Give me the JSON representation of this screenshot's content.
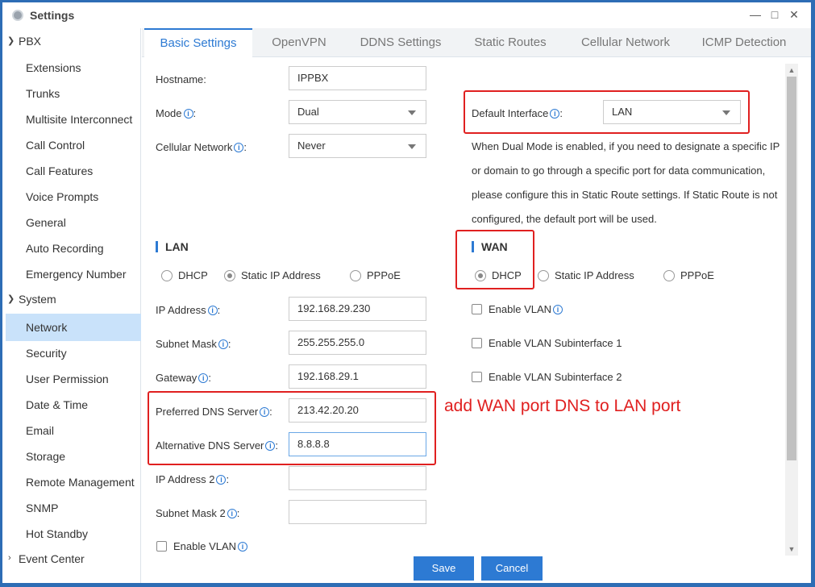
{
  "window": {
    "title": "Settings"
  },
  "sidebar": {
    "groups": [
      {
        "label": "PBX",
        "items": [
          "Extensions",
          "Trunks",
          "Multisite Interconnect",
          "Call Control",
          "Call Features",
          "Voice Prompts",
          "General",
          "Auto Recording",
          "Emergency Number"
        ]
      },
      {
        "label": "System",
        "items": [
          "Network",
          "Security",
          "User Permission",
          "Date & Time",
          "Email",
          "Storage",
          "Remote Management",
          "SNMP",
          "Hot Standby"
        ]
      },
      {
        "label": "Event Center",
        "items": []
      }
    ],
    "active_item": "Network"
  },
  "tabs": [
    "Basic Settings",
    "OpenVPN",
    "DDNS Settings",
    "Static Routes",
    "Cellular Network",
    "ICMP Detection"
  ],
  "form": {
    "hostname_label": "Hostname:",
    "hostname_value": "IPPBX",
    "mode_label": "Mode",
    "mode_value": "Dual",
    "cellular_label": "Cellular Network",
    "cellular_value": "Never",
    "default_interface_label": "Default Interface",
    "default_interface_value": "LAN",
    "colon": ":",
    "description": "When Dual Mode is enabled, if you need to designate a specific IP or domain to go through a specific port for data communication, please configure this in Static Route settings. If Static Route is not configured, the default port will be used."
  },
  "lan": {
    "title": "LAN",
    "radios": [
      "DHCP",
      "Static IP Address",
      "PPPoE"
    ],
    "selected": "Static IP Address",
    "ip_label": "IP Address",
    "ip_value": "192.168.29.230",
    "subnet_label": "Subnet Mask",
    "subnet_value": "255.255.255.0",
    "gateway_label": "Gateway",
    "gateway_value": "192.168.29.1",
    "dns1_label": "Preferred DNS Server",
    "dns1_value": "213.42.20.20",
    "dns2_label": "Alternative DNS Server",
    "dns2_value": "8.8.8.8",
    "ip2_label": "IP Address 2",
    "ip2_value": "",
    "subnet2_label": "Subnet Mask 2",
    "subnet2_value": "",
    "vlan_label": "Enable VLAN"
  },
  "wan": {
    "title": "WAN",
    "radios": [
      "DHCP",
      "Static IP Address",
      "PPPoE"
    ],
    "selected": "DHCP",
    "vlan_label": "Enable VLAN",
    "vlan_sub1_label": "Enable VLAN Subinterface 1",
    "vlan_sub2_label": "Enable VLAN Subinterface 2"
  },
  "annotation": "add WAN port DNS to LAN port",
  "buttons": {
    "save": "Save",
    "cancel": "Cancel"
  },
  "colors": {
    "accent": "#2d7ad3",
    "highlight": "#e02020",
    "active_nav": "#c9e2fa"
  }
}
